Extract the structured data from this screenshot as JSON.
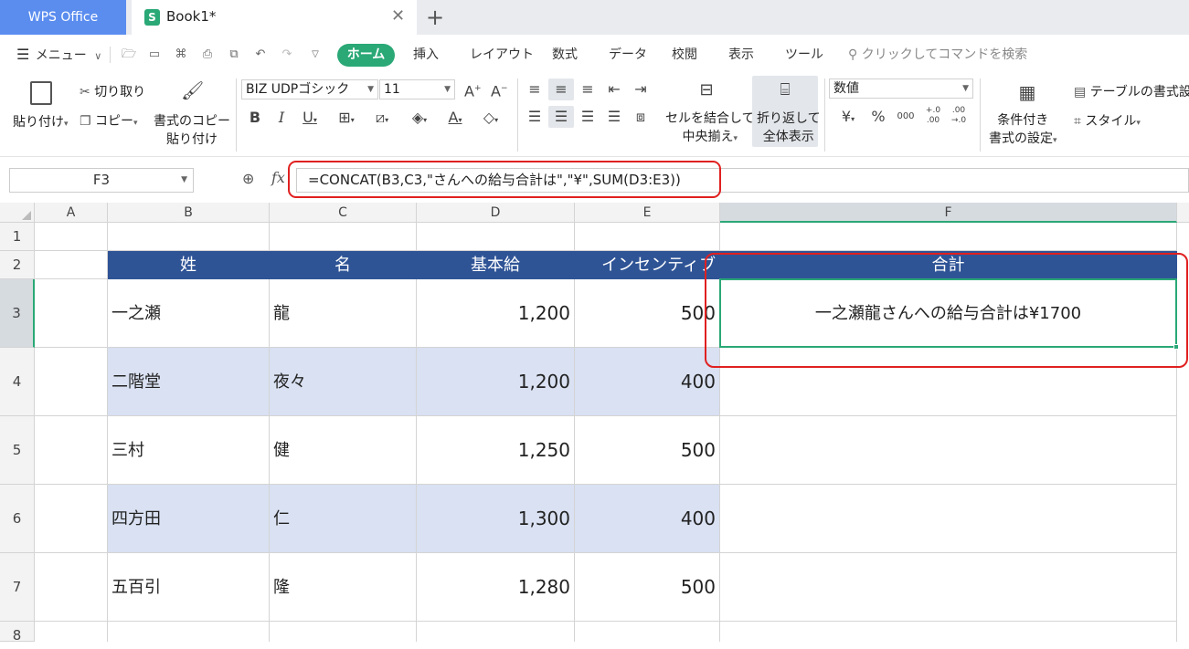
{
  "tabs": {
    "app": "WPS Office",
    "doc_icon": "S",
    "doc": "Book1*",
    "close": "✕",
    "new": "+"
  },
  "menu": {
    "main": "メニュー",
    "items": [
      "ホーム",
      "挿入",
      "レイアウト",
      "数式",
      "データ",
      "校閲",
      "表示",
      "ツール"
    ],
    "search_placeholder": "クリックしてコマンドを検索"
  },
  "ribbon": {
    "paste": "貼り付け",
    "cut": "切り取り",
    "copy": "コピー",
    "format_painter_1": "書式のコピー",
    "format_painter_2": "貼り付け",
    "font_name": "BIZ UDPゴシック",
    "font_size": "11",
    "merge_center_1": "セルを結合して",
    "merge_center_2": "中央揃え",
    "wrap_text_1": "折り返して",
    "wrap_text_2": "全体表示",
    "number_format": "数値",
    "conditional_1": "条件付き",
    "conditional_2": "書式の設定",
    "table_format": "テーブルの書式設定",
    "style": "スタイル",
    "percent": "%"
  },
  "formula_bar": {
    "name_box": "F3",
    "fx": "fx",
    "formula": "=CONCAT(B3,C3,\"さんへの給与合計は\",\"¥\",SUM(D3:E3))"
  },
  "sheet": {
    "columns": [
      "A",
      "B",
      "C",
      "D",
      "E",
      "F"
    ],
    "rows": [
      "1",
      "2",
      "3",
      "4",
      "5",
      "6",
      "7",
      "8"
    ],
    "headers": [
      "姓",
      "名",
      "基本給",
      "インセンティブ",
      "合計"
    ],
    "data": [
      {
        "last": "一之瀬",
        "first": "龍",
        "base": "1,200",
        "incentive": "500",
        "total": "一之瀬龍さんへの給与合計は¥1700"
      },
      {
        "last": "二階堂",
        "first": "夜々",
        "base": "1,200",
        "incentive": "400",
        "total": ""
      },
      {
        "last": "三村",
        "first": "健",
        "base": "1,250",
        "incentive": "500",
        "total": ""
      },
      {
        "last": "四方田",
        "first": "仁",
        "base": "1,300",
        "incentive": "400",
        "total": ""
      },
      {
        "last": "五百引",
        "first": "隆",
        "base": "1,280",
        "incentive": "500",
        "total": ""
      }
    ],
    "selected_cell": "F3"
  },
  "colors": {
    "accent": "#2aa876",
    "header_fill": "#2f5496",
    "band_fill": "#d9e1f2",
    "highlight": "#e02020",
    "tab_blue": "#5b8def"
  },
  "icons": [
    "hamburger-icon",
    "chevron-down-icon",
    "open-icon",
    "save-icon",
    "format-painter-icon",
    "print-icon",
    "print-preview-icon",
    "undo-icon",
    "redo-icon",
    "search-icon",
    "paste-icon",
    "scissors-icon",
    "copy-icon",
    "bold-icon",
    "italic-icon",
    "underline-icon",
    "border-icon",
    "fill-color-icon",
    "font-color-icon",
    "eraser-icon",
    "align-icon",
    "merge-icon",
    "wrap-icon",
    "table-icon",
    "zoom-icon",
    "fx-icon"
  ]
}
